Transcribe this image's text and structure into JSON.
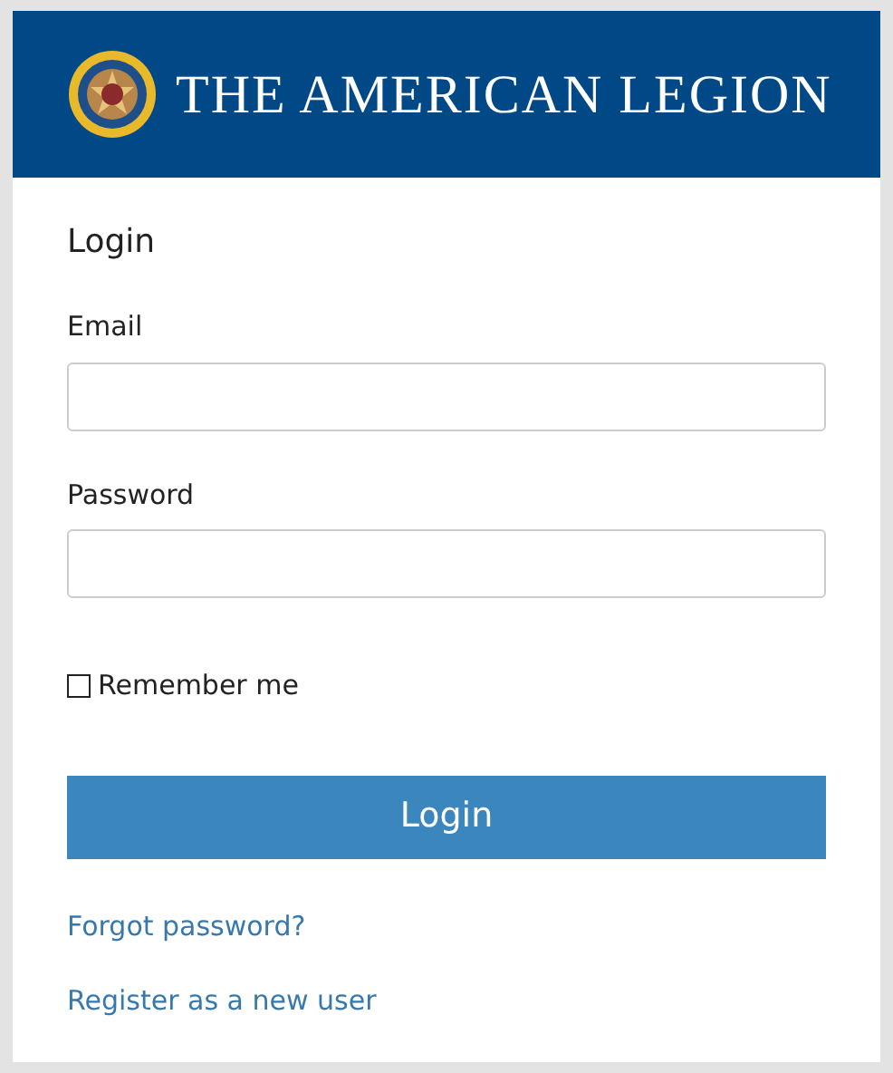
{
  "header": {
    "title": "THE AMERICAN LEGION"
  },
  "form": {
    "heading": "Login",
    "fields": [
      {
        "label": "Email"
      },
      {
        "label": "Password"
      }
    ],
    "remember": {
      "label": "Remember me",
      "checked": false
    },
    "submit": "Login",
    "links": [
      "Forgot password?",
      "Register as a new user"
    ]
  }
}
